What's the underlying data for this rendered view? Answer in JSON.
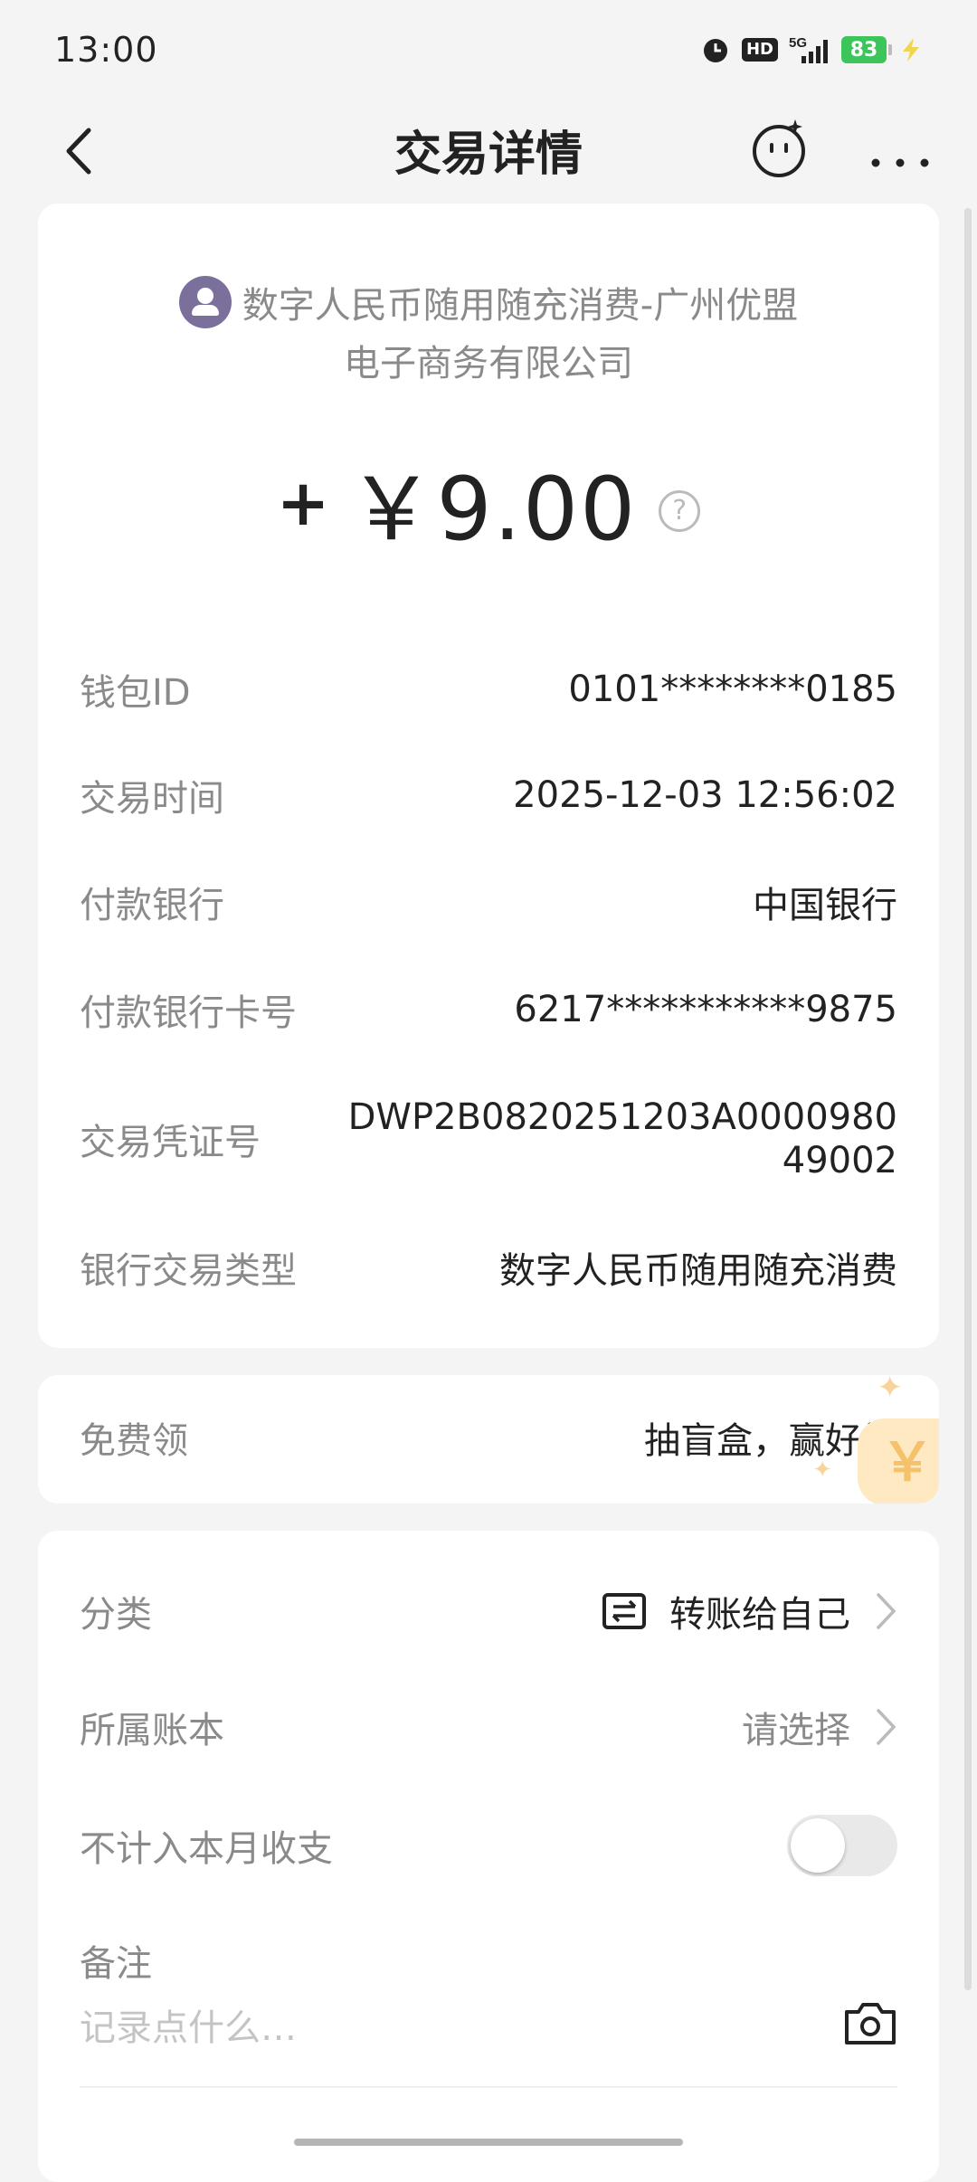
{
  "status_bar": {
    "time": "13:00",
    "hd": "HD",
    "network": "5G",
    "battery": "83",
    "icons": [
      "alarm-icon",
      "hd-icon",
      "signal-5g-icon",
      "battery-icon",
      "charging-icon"
    ]
  },
  "navbar": {
    "title": "交易详情",
    "back_icon": "chevron-left-icon",
    "assistant_icon": "smiley-robot-icon",
    "more_icon": "more-dots-icon"
  },
  "transaction": {
    "merchant_line1": "数字人民币随用随充消费-广州优盟",
    "merchant_line2": "电子商务有限公司",
    "amount_sign": "+",
    "amount": "￥9.00",
    "help_symbol": "?",
    "details": [
      {
        "label": "钱包ID",
        "value": "0101********0185"
      },
      {
        "label": "交易时间",
        "value": "2025-12-03 12:56:02"
      },
      {
        "label": "付款银行",
        "value": "中国银行"
      },
      {
        "label": "付款银行卡号",
        "value": "6217***********9875"
      },
      {
        "label": "交易凭证号",
        "value": "DWP2B0820251203A000098049002"
      },
      {
        "label": "银行交易类型",
        "value": "数字人民币随用随充消费"
      }
    ]
  },
  "promo": {
    "label": "免费领",
    "value": "抽盲盒，赢好礼",
    "deco_symbol": "￥"
  },
  "meta": {
    "category_label": "分类",
    "category_value": "转账给自己",
    "category_icon": "transfer-icon",
    "ledger_label": "所属账本",
    "ledger_value": "请选择",
    "exclude_label": "不计入本月收支",
    "exclude_on": false,
    "note_label": "备注",
    "note_placeholder": "记录点什么…",
    "camera_icon": "camera-icon"
  }
}
